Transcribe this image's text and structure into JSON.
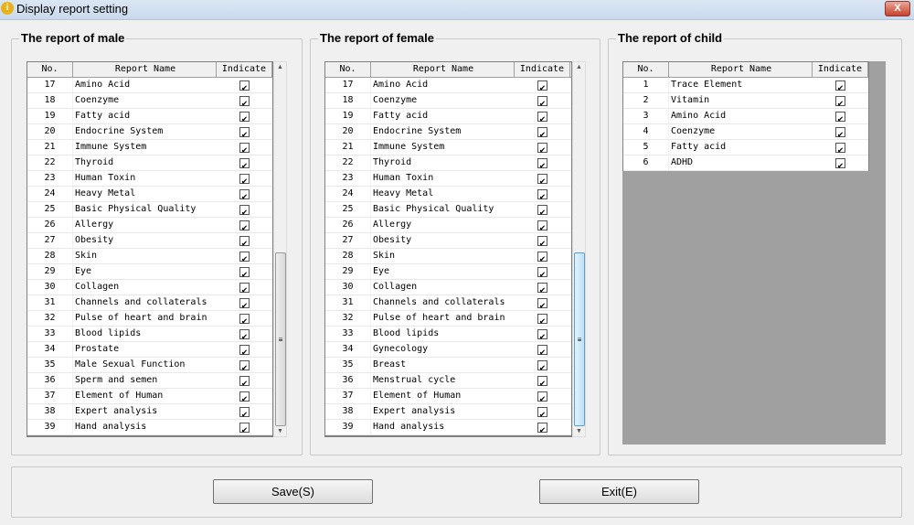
{
  "window": {
    "title": "Display report setting",
    "close_label": "X"
  },
  "columns": {
    "no": "No.",
    "name": "Report Name",
    "indicate": "Indicate"
  },
  "male": {
    "title": "The report of male",
    "rows": [
      [
        17,
        "Amino Acid"
      ],
      [
        18,
        "Coenzyme"
      ],
      [
        19,
        "Fatty acid"
      ],
      [
        20,
        "Endocrine System"
      ],
      [
        21,
        "Immune System"
      ],
      [
        22,
        "Thyroid"
      ],
      [
        23,
        "Human Toxin"
      ],
      [
        24,
        "Heavy Metal"
      ],
      [
        25,
        "Basic Physical Quality"
      ],
      [
        26,
        "Allergy"
      ],
      [
        27,
        "Obesity"
      ],
      [
        28,
        "Skin"
      ],
      [
        29,
        "Eye"
      ],
      [
        30,
        "Collagen"
      ],
      [
        31,
        "Channels and collaterals"
      ],
      [
        32,
        "Pulse of heart and brain"
      ],
      [
        33,
        "Blood lipids"
      ],
      [
        34,
        "Prostate"
      ],
      [
        35,
        "Male Sexual Function"
      ],
      [
        36,
        "Sperm and semen"
      ],
      [
        37,
        "Element of Human"
      ],
      [
        38,
        "Expert analysis"
      ],
      [
        39,
        "Hand analysis"
      ]
    ]
  },
  "female": {
    "title": "The report of female",
    "rows": [
      [
        17,
        "Amino Acid"
      ],
      [
        18,
        "Coenzyme"
      ],
      [
        19,
        "Fatty acid"
      ],
      [
        20,
        "Endocrine System"
      ],
      [
        21,
        "Immune System"
      ],
      [
        22,
        "Thyroid"
      ],
      [
        23,
        "Human Toxin"
      ],
      [
        24,
        "Heavy Metal"
      ],
      [
        25,
        "Basic Physical Quality"
      ],
      [
        26,
        "Allergy"
      ],
      [
        27,
        "Obesity"
      ],
      [
        28,
        "Skin"
      ],
      [
        29,
        "Eye"
      ],
      [
        30,
        "Collagen"
      ],
      [
        31,
        "Channels and collaterals"
      ],
      [
        32,
        "Pulse of heart and brain"
      ],
      [
        33,
        "Blood lipids"
      ],
      [
        34,
        "Gynecology"
      ],
      [
        35,
        "Breast"
      ],
      [
        36,
        "Menstrual cycle"
      ],
      [
        37,
        "Element of Human"
      ],
      [
        38,
        "Expert analysis"
      ],
      [
        39,
        "Hand analysis"
      ]
    ]
  },
  "child": {
    "title": "The report of child",
    "rows": [
      [
        1,
        "Trace Element"
      ],
      [
        2,
        "Vitamin"
      ],
      [
        3,
        "Amino Acid"
      ],
      [
        4,
        "Coenzyme"
      ],
      [
        5,
        "Fatty acid"
      ],
      [
        6,
        "ADHD"
      ]
    ]
  },
  "buttons": {
    "save": "Save(S)",
    "exit": "Exit(E)"
  }
}
